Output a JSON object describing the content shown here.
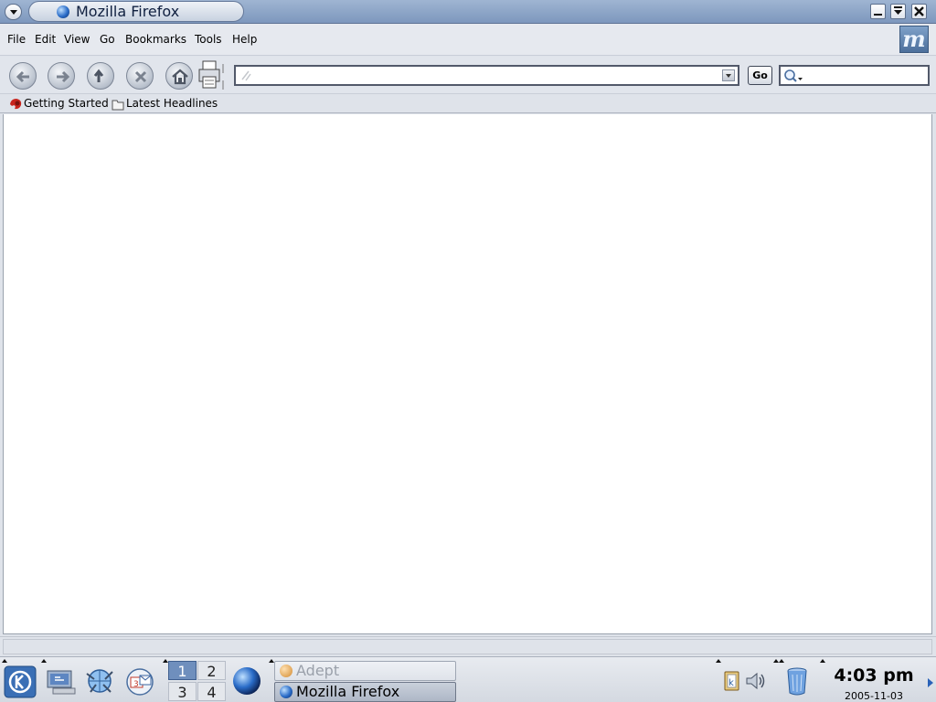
{
  "window": {
    "title": "Mozilla Firefox",
    "buttons": [
      "minimize",
      "maximize",
      "close"
    ]
  },
  "menubar": {
    "items": [
      "File",
      "Edit",
      "View",
      "Go",
      "Bookmarks",
      "Tools",
      "Help"
    ],
    "brand_logo": "m"
  },
  "navbar": {
    "buttons": [
      "back-icon",
      "forward-icon",
      "reload-icon",
      "stop-icon",
      "home-icon",
      "print-icon"
    ],
    "url_value": "",
    "go_label": "Go",
    "search_value": ""
  },
  "bookmarks": {
    "items": [
      {
        "label": "Getting Started",
        "icon": "firefox-bookmark-icon"
      },
      {
        "label": "Latest Headlines",
        "icon": "livemark-folder-icon"
      }
    ]
  },
  "content": {
    "url": ""
  },
  "taskbar": {
    "launchers": [
      "kde-menu-icon",
      "desktop-icon",
      "konqueror-icon",
      "kontact-icon",
      "firefox-icon"
    ],
    "pager": [
      "1",
      "2",
      "3",
      "4"
    ],
    "active_desktop": "1",
    "tasks": [
      {
        "label": "Adept",
        "active": false
      },
      {
        "label": "Mozilla Firefox",
        "active": true
      }
    ],
    "tray": [
      "klipper-icon",
      "volume-icon",
      "trash-icon"
    ],
    "clock_time": "4:03 pm",
    "clock_date": "2005-11-03"
  }
}
